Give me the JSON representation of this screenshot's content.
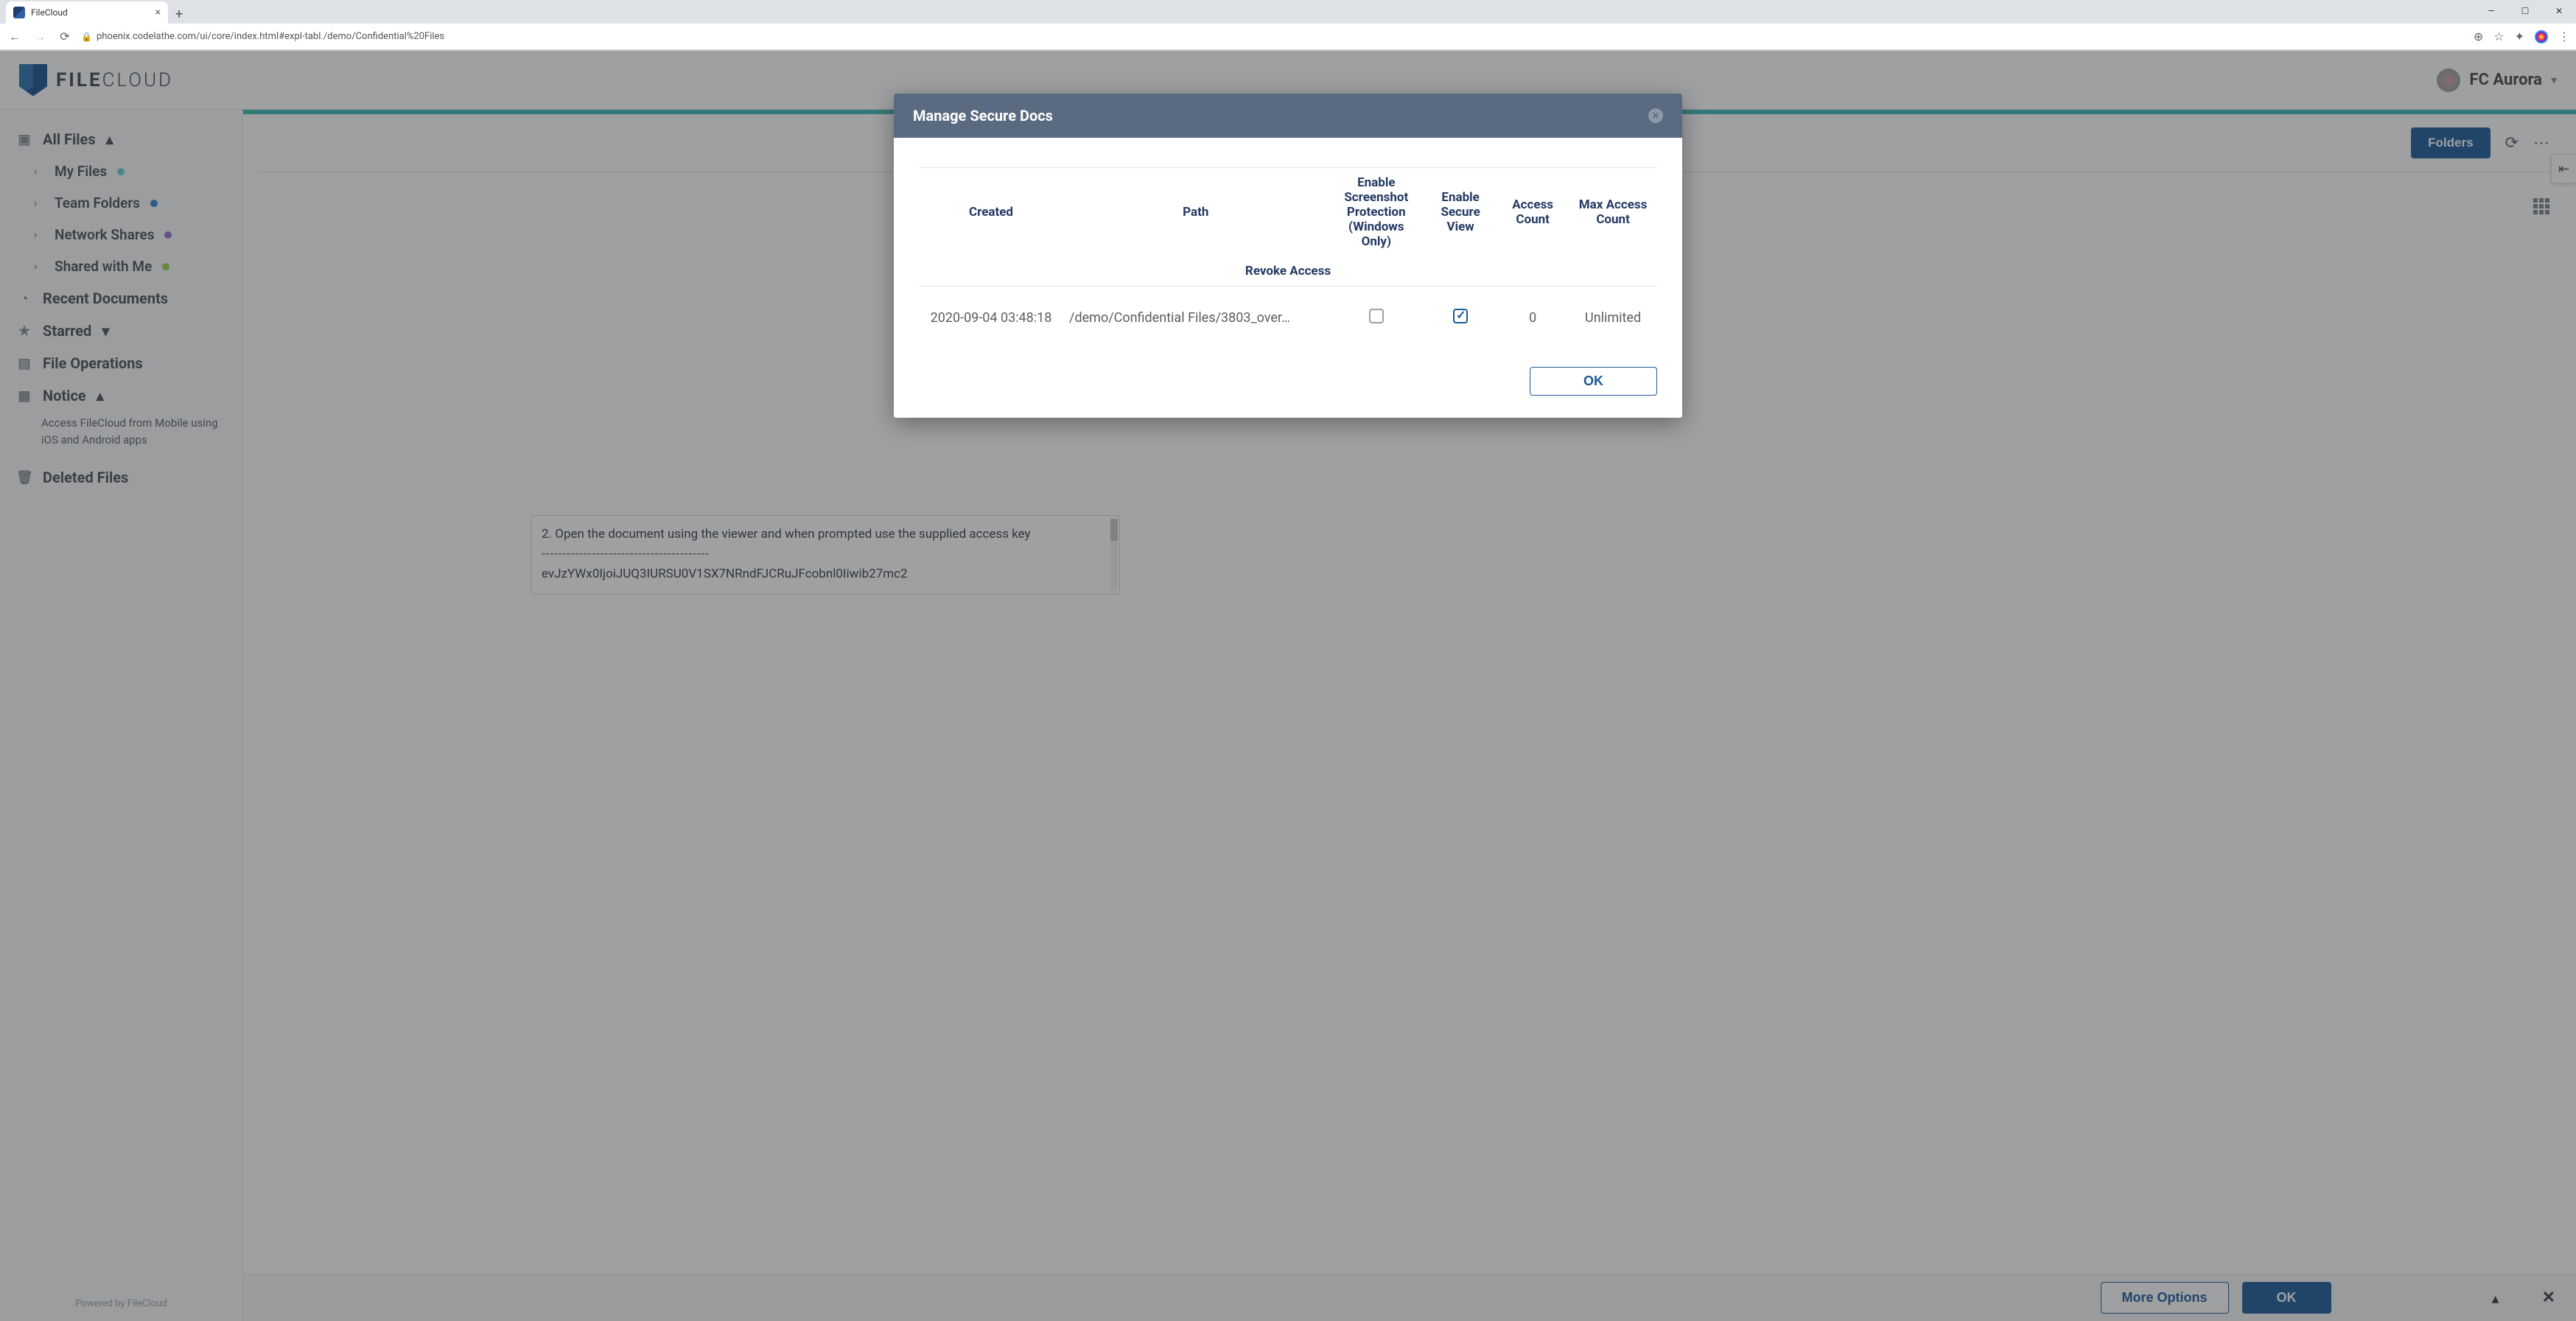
{
  "browser": {
    "tab_title": "FileCloud",
    "url": "phoenix.codelathe.com/ui/core/index.html#expl-tabl./demo/Confidential%20Files"
  },
  "brand": {
    "first": "FILE",
    "second": "CLOUD"
  },
  "user": {
    "name": "FC Aurora"
  },
  "sidebar": {
    "all_files": "All Files",
    "items": [
      {
        "label": "My Files",
        "dot": "#66d1cc"
      },
      {
        "label": "Team Folders",
        "dot": "#2f7fd3"
      },
      {
        "label": "Network Shares",
        "dot": "#9a6fd0"
      },
      {
        "label": "Shared with Me",
        "dot": "#9bcf4e"
      }
    ],
    "recent": "Recent Documents",
    "starred": "Starred",
    "fileops": "File Operations",
    "notice": "Notice",
    "notice_text": "Access FileCloud from Mobile using iOS and Android apps",
    "deleted": "Deleted Files",
    "powered": "Powered by FileCloud"
  },
  "toolbar": {
    "folders_btn": "Folders"
  },
  "note": {
    "line2": "2. Open the document using the viewer and when prompted use the supplied access key",
    "dashes": "----------------------------------------",
    "keyfrag": "evJzYWx0IjoiJUQ3IURSU0V1SX7NRndFJCRuJFcobnl0Iiwib27mc2"
  },
  "bottom": {
    "more": "More Options",
    "ok": "OK"
  },
  "modal": {
    "title": "Manage Secure Docs",
    "headers": {
      "created": "Created",
      "path": "Path",
      "screenshot": "Enable Screenshot Protection (Windows Only)",
      "secureview": "Enable Secure View",
      "access_count": "Access Count",
      "max_access": "Max Access Count",
      "revoke": "Revoke Access"
    },
    "row": {
      "created": "2020-09-04 03:48:18",
      "path": "/demo/Confidential Files/3803_over…",
      "screenshot_checked": false,
      "secureview_checked": true,
      "access_count": "0",
      "max_access": "Unlimited"
    },
    "ok": "OK"
  }
}
